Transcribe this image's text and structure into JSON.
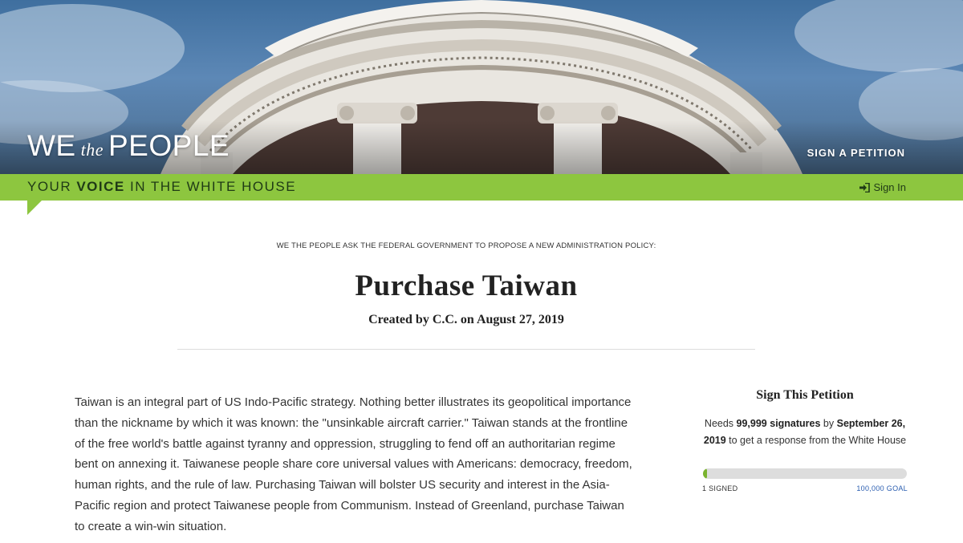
{
  "header": {
    "logo": {
      "we": "WE",
      "the": "the",
      "people": "PEOPLE"
    },
    "nav_sign_petition": "SIGN A PETITION"
  },
  "tagbar": {
    "tagline_pre": "YOUR ",
    "tagline_bold": "VOICE",
    "tagline_post": " IN THE WHITE HOUSE",
    "sign_in": "Sign In"
  },
  "petition": {
    "ask": "WE THE PEOPLE ASK THE FEDERAL GOVERNMENT TO PROPOSE A NEW ADMINISTRATION POLICY:",
    "title": "Purchase Taiwan",
    "created": "Created by C.C. on August 27, 2019",
    "body": "Taiwan is an integral part of US Indo-Pacific strategy. Nothing better illustrates its geopolitical importance than the nickname by which it was known: the \"unsinkable aircraft carrier.\" Taiwan stands at the frontline of the free world's battle against tyranny and oppression, struggling to fend off an authoritarian regime bent on annexing it. Taiwanese people share core universal values with Americans: democracy, freedom, human rights, and the rule of law. Purchasing Taiwan will bolster US security and interest in the Asia-Pacific region and protect Taiwanese people from Communism. Instead of Greenland, purchase Taiwan to create a win-win situation."
  },
  "sidebar": {
    "title": "Sign This Petition",
    "needs_pre": "Needs ",
    "needs_count": "99,999 signatures",
    "needs_by": " by ",
    "needs_date": "September 26, 2019",
    "needs_post": " to get a response from the White House",
    "signed_label": "1 SIGNED",
    "goal_label": "100,000 GOAL",
    "progress_fraction": 1e-05
  },
  "colors": {
    "green_bar": "#8dc63f",
    "progress_fill": "#7ab32e",
    "goal_link": "#2a5db0"
  }
}
